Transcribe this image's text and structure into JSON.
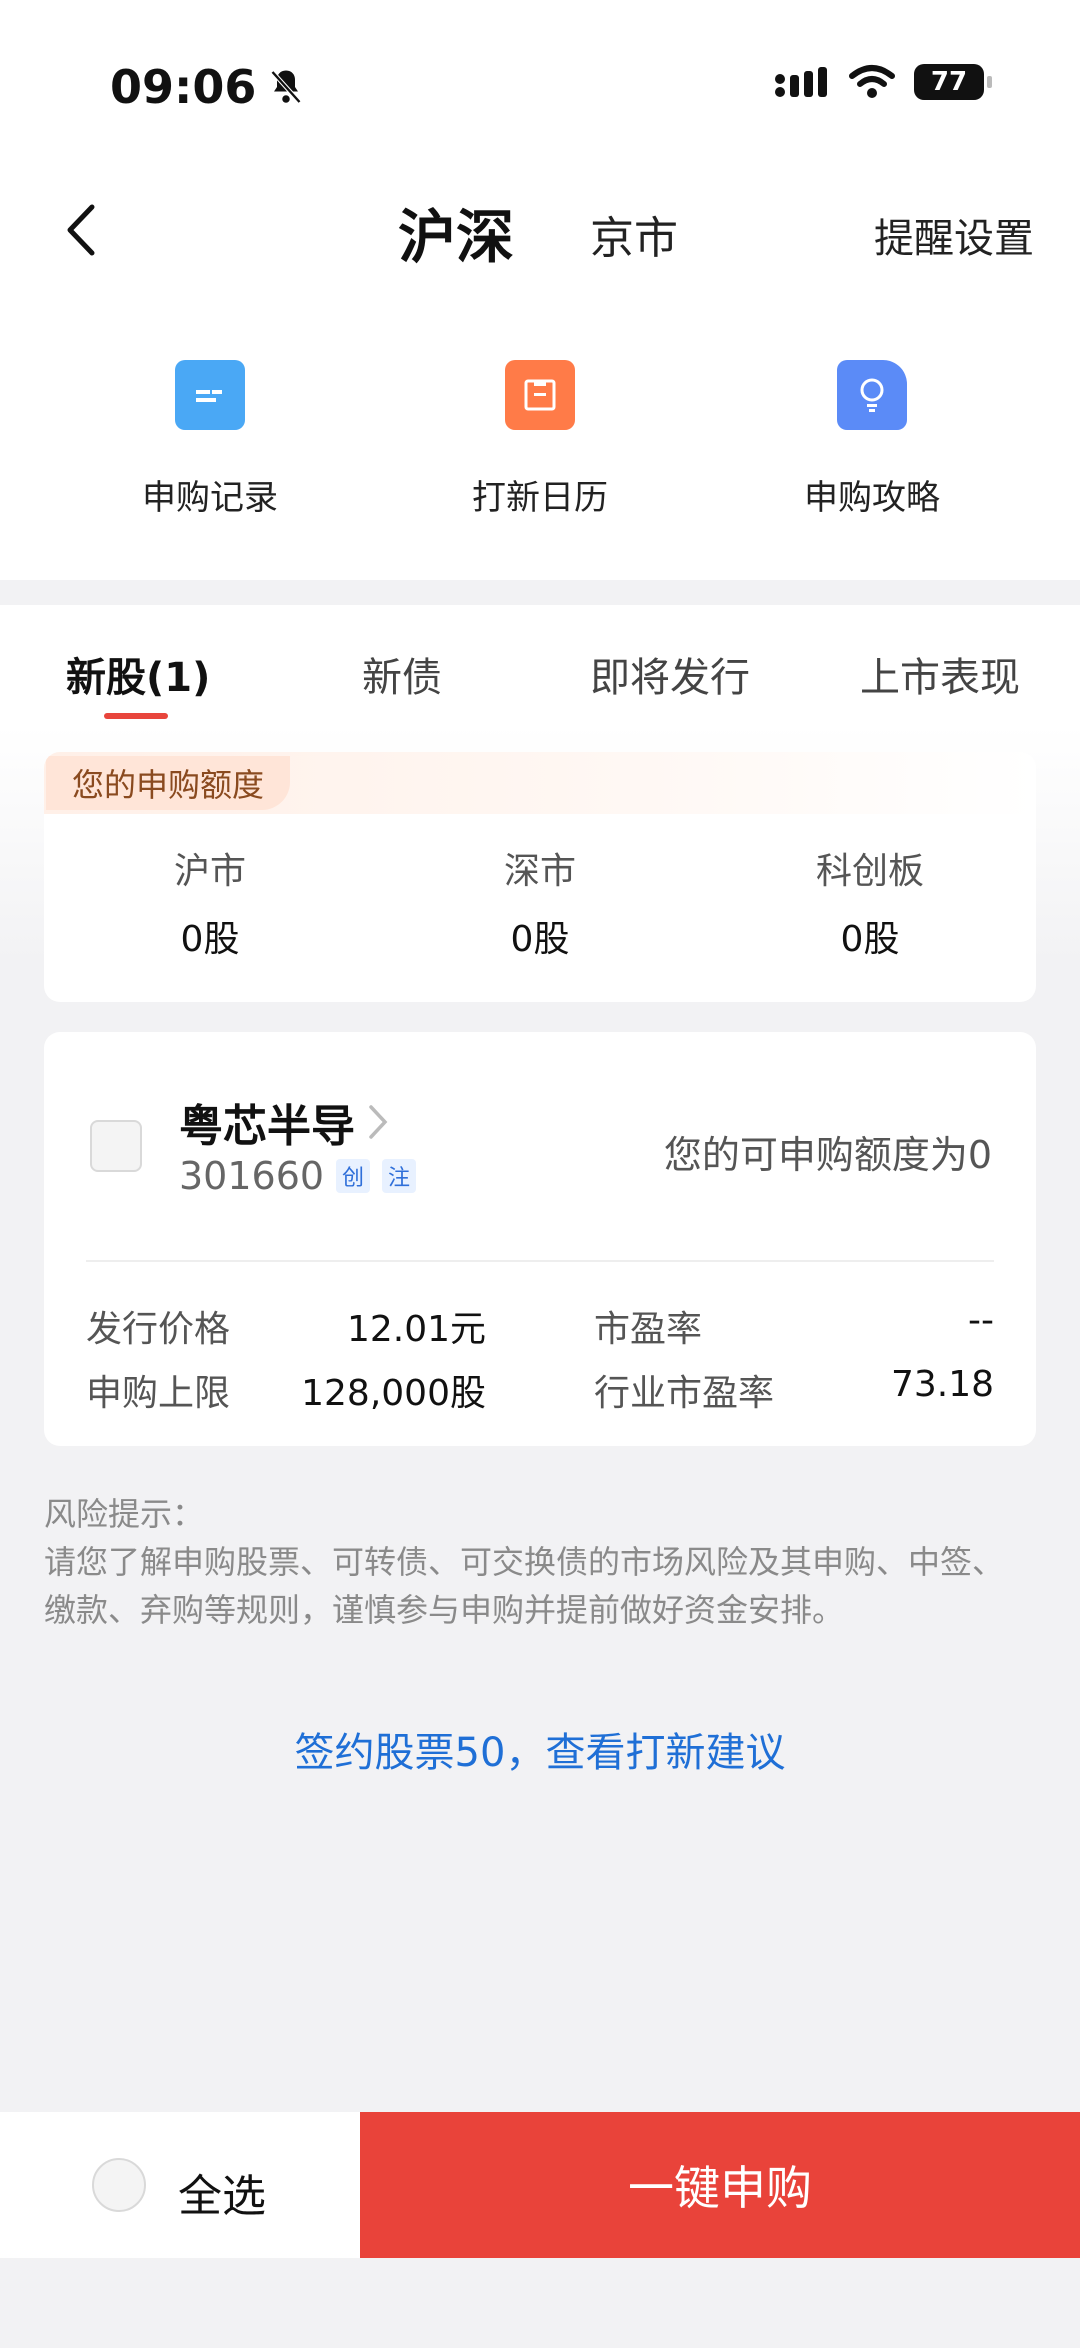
{
  "status_bar": {
    "time": "09:06",
    "battery": "77"
  },
  "header": {
    "segments": [
      "沪深",
      "京市"
    ],
    "remind_label": "提醒设置"
  },
  "quick_actions": [
    {
      "label": "申购记录",
      "icon": "record-icon",
      "color": "#4aa8f5"
    },
    {
      "label": "打新日历",
      "icon": "calendar-icon",
      "color": "#ff7b48"
    },
    {
      "label": "申购攻略",
      "icon": "lightbulb-icon",
      "color": "#5b8bf7"
    }
  ],
  "tabs": [
    "新股(1)",
    "新债",
    "即将发行",
    "上市表现"
  ],
  "quota": {
    "title": "您的申购额度",
    "cols": [
      {
        "name": "沪市",
        "value": "0股"
      },
      {
        "name": "深市",
        "value": "0股"
      },
      {
        "name": "科创板",
        "value": "0股"
      }
    ]
  },
  "stock": {
    "name": "粤芯半导",
    "code": "301660",
    "tags": [
      "创",
      "注"
    ],
    "quota_text": "您的可申购额度为0",
    "rows": [
      {
        "label": "发行价格",
        "value": "12.01元",
        "label2": "市盈率",
        "value2": "--"
      },
      {
        "label": "申购上限",
        "value": "128,000股",
        "label2": "行业市盈率",
        "value2": "73.18"
      }
    ]
  },
  "risk": {
    "title": "风险提示：",
    "text": "请您了解申购股票、可转债、可交换债的市场风险及其申购、中签、缴款、弃购等规则，谨慎参与申购并提前做好资金安排。"
  },
  "sign_link": "签约股票50，查看打新建议",
  "bottom": {
    "select_all": "全选",
    "subscribe": "一键申购"
  },
  "colors": {
    "accent": "#e9433a",
    "link": "#1f6fd6"
  }
}
